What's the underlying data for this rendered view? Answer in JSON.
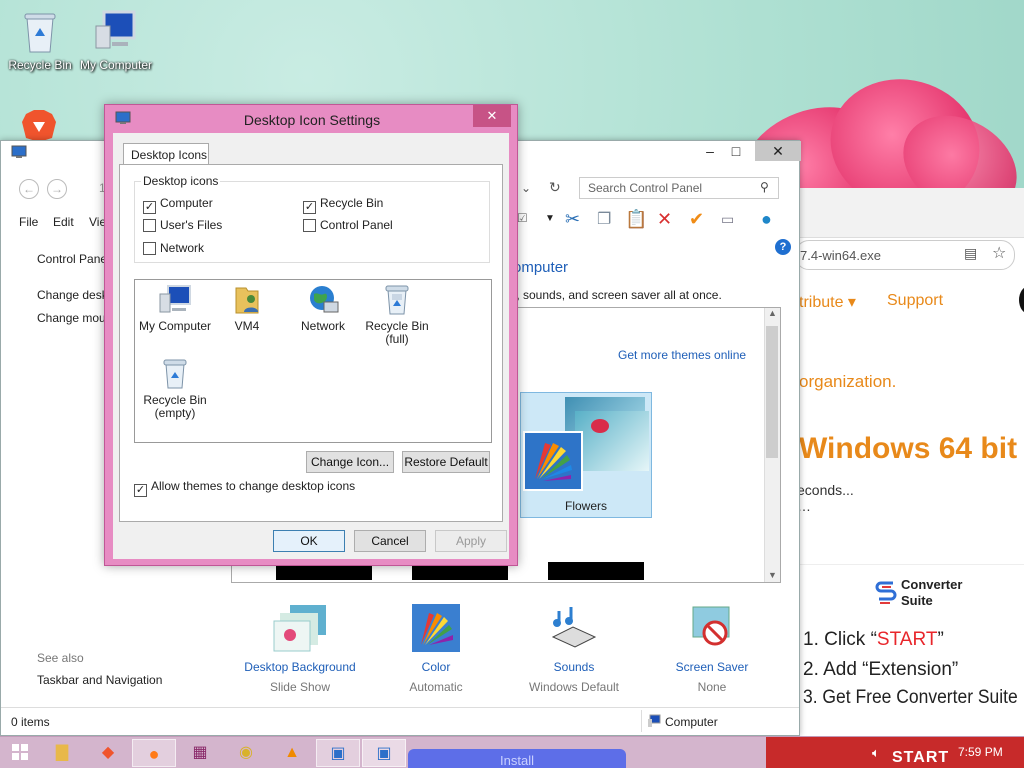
{
  "desktop": {
    "icons": [
      {
        "label": "Recycle Bin",
        "icon": "recycle-bin-icon"
      },
      {
        "label": "My Computer",
        "icon": "computer-icon"
      }
    ]
  },
  "browser": {
    "url": "7.4-win64.exe",
    "nav": [
      "tribute ▾",
      "Support"
    ],
    "text1": "organization.",
    "headline": "Windows 64 bit",
    "text2": "econds...",
    "text3": "…",
    "ad": {
      "brand1": "Converter",
      "brand2": "Suite",
      "step1_prefix": "1. Click “",
      "step1_word": "START",
      "step1_suffix": "”",
      "step2": "2. Add “Extension”",
      "step3": "3. Get Free Converter Suite",
      "start_badge": "START",
      "install": "Install"
    }
  },
  "control_panel": {
    "search_placeholder": "Search Control Panel",
    "addr_prefix": "1",
    "menu": [
      "File",
      "Edit",
      "Vie"
    ],
    "side_links": [
      "Control Pane",
      "Change desk",
      "Change mou"
    ],
    "see_also": "See also",
    "see_also_link": "Taskbar and Navigation",
    "heading": "omputer",
    "subheading": "r, sounds, and screen saver all at once.",
    "more_themes": "Get more themes online",
    "theme_name": "Flowers",
    "bottom": [
      {
        "label": "Desktop Background",
        "sub": "Slide Show",
        "icon": "desktop-background-icon"
      },
      {
        "label": "Color",
        "sub": "Automatic",
        "icon": "color-icon"
      },
      {
        "label": "Sounds",
        "sub": "Windows Default",
        "icon": "sounds-icon"
      },
      {
        "label": "Screen Saver",
        "sub": "None",
        "icon": "screen-saver-icon"
      }
    ],
    "status_left": "0 items",
    "status_right": "Computer"
  },
  "dialog": {
    "title": "Desktop Icon Settings",
    "tab": "Desktop Icons",
    "group_title": "Desktop icons",
    "checkboxes": [
      {
        "label": "Computer",
        "checked": true
      },
      {
        "label": "Recycle Bin",
        "checked": true
      },
      {
        "label": "User's Files",
        "checked": false
      },
      {
        "label": "Control Panel",
        "checked": false
      },
      {
        "label": "Network",
        "checked": false
      }
    ],
    "icons": [
      {
        "label": "My Computer"
      },
      {
        "label": "VM4"
      },
      {
        "label": "Network"
      },
      {
        "label": "Recycle Bin\n(full)"
      },
      {
        "label": "Recycle Bin\n(empty)"
      }
    ],
    "change_icon": "Change Icon...",
    "restore_default": "Restore Default",
    "allow_themes": "Allow themes to change desktop icons",
    "allow_themes_checked": true,
    "ok": "OK",
    "cancel": "Cancel",
    "apply": "Apply"
  },
  "taskbar": {
    "time": "7:59 PM"
  }
}
